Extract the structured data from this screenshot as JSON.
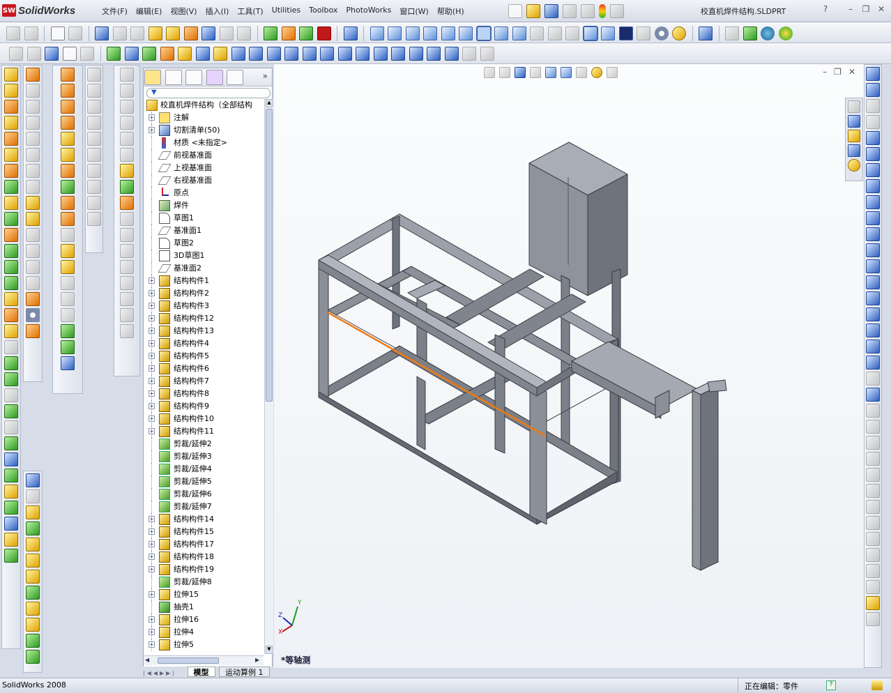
{
  "app": {
    "name": "SolidWorks",
    "document_title": "校直机焊件结构.SLDPRT"
  },
  "menu": [
    "文件(F)",
    "编辑(E)",
    "视图(V)",
    "插入(I)",
    "工具(T)",
    "Utilities",
    "Toolbox",
    "PhotoWorks",
    "窗口(W)",
    "帮助(H)"
  ],
  "feature_manager": {
    "root": "校直机焊件结构（全部结构",
    "items": [
      {
        "label": "注解",
        "icon": "annotation-icon",
        "expandable": true
      },
      {
        "label": "切割清单(50)",
        "icon": "cut-list-icon",
        "expandable": true
      },
      {
        "label": "材质 <未指定>",
        "icon": "material-icon",
        "expandable": false
      },
      {
        "label": "前视基准面",
        "icon": "plane-icon",
        "expandable": false
      },
      {
        "label": "上视基准面",
        "icon": "plane-icon",
        "expandable": false
      },
      {
        "label": "右视基准面",
        "icon": "plane-icon",
        "expandable": false
      },
      {
        "label": "原点",
        "icon": "origin-icon",
        "expandable": false
      },
      {
        "label": "焊件",
        "icon": "weldment-icon",
        "expandable": false
      },
      {
        "label": "草图1",
        "icon": "sketch-icon",
        "expandable": false
      },
      {
        "label": "基准面1",
        "icon": "plane-icon",
        "expandable": false
      },
      {
        "label": "草图2",
        "icon": "sketch-icon",
        "expandable": false
      },
      {
        "label": "3D草图1",
        "icon": "sketch3d-icon",
        "expandable": false
      },
      {
        "label": "基准面2",
        "icon": "plane-icon",
        "expandable": false
      },
      {
        "label": "结构构件1",
        "icon": "structural-member-icon",
        "expandable": true
      },
      {
        "label": "结构构件2",
        "icon": "structural-member-icon",
        "expandable": true
      },
      {
        "label": "结构构件3",
        "icon": "structural-member-icon",
        "expandable": true
      },
      {
        "label": "结构构件12",
        "icon": "structural-member-icon",
        "expandable": true
      },
      {
        "label": "结构构件13",
        "icon": "structural-member-icon",
        "expandable": true
      },
      {
        "label": "结构构件4",
        "icon": "structural-member-icon",
        "expandable": true
      },
      {
        "label": "结构构件5",
        "icon": "structural-member-icon",
        "expandable": true
      },
      {
        "label": "结构构件6",
        "icon": "structural-member-icon",
        "expandable": true
      },
      {
        "label": "结构构件7",
        "icon": "structural-member-icon",
        "expandable": true
      },
      {
        "label": "结构构件8",
        "icon": "structural-member-icon",
        "expandable": true
      },
      {
        "label": "结构构件9",
        "icon": "structural-member-icon",
        "expandable": true
      },
      {
        "label": "结构构件10",
        "icon": "structural-member-icon",
        "expandable": true
      },
      {
        "label": "结构构件11",
        "icon": "structural-member-icon",
        "expandable": true
      },
      {
        "label": "剪裁/延伸2",
        "icon": "trim-extend-icon",
        "expandable": false
      },
      {
        "label": "剪裁/延伸3",
        "icon": "trim-extend-icon",
        "expandable": false
      },
      {
        "label": "剪裁/延伸4",
        "icon": "trim-extend-icon",
        "expandable": false
      },
      {
        "label": "剪裁/延伸5",
        "icon": "trim-extend-icon",
        "expandable": false
      },
      {
        "label": "剪裁/延伸6",
        "icon": "trim-extend-icon",
        "expandable": false
      },
      {
        "label": "剪裁/延伸7",
        "icon": "trim-extend-icon",
        "expandable": false
      },
      {
        "label": "结构构件14",
        "icon": "structural-member-icon",
        "expandable": true
      },
      {
        "label": "结构构件15",
        "icon": "structural-member-icon",
        "expandable": true
      },
      {
        "label": "结构构件17",
        "icon": "structural-member-icon",
        "expandable": true
      },
      {
        "label": "结构构件18",
        "icon": "structural-member-icon",
        "expandable": true
      },
      {
        "label": "结构构件19",
        "icon": "structural-member-icon",
        "expandable": true
      },
      {
        "label": "剪裁/延伸8",
        "icon": "trim-extend-icon",
        "expandable": false
      },
      {
        "label": "拉伸15",
        "icon": "extrude-icon",
        "expandable": true
      },
      {
        "label": "抽壳1",
        "icon": "shell-icon",
        "expandable": false
      },
      {
        "label": "拉伸16",
        "icon": "extrude-icon",
        "expandable": true
      },
      {
        "label": "拉伸4",
        "icon": "extrude-icon",
        "expandable": true
      },
      {
        "label": "拉伸5",
        "icon": "extrude-icon",
        "expandable": true
      }
    ]
  },
  "bottom_tabs": [
    "模型",
    "运动算例 1"
  ],
  "viewport": {
    "view_label": "*等轴测",
    "triad": {
      "x": "X",
      "y": "Y",
      "z": "Z"
    }
  },
  "status": {
    "version": "SolidWorks 2008",
    "editing": "正在编辑：零件"
  },
  "colors": {
    "accent": "#f07a10",
    "frame": "#7d828c"
  }
}
